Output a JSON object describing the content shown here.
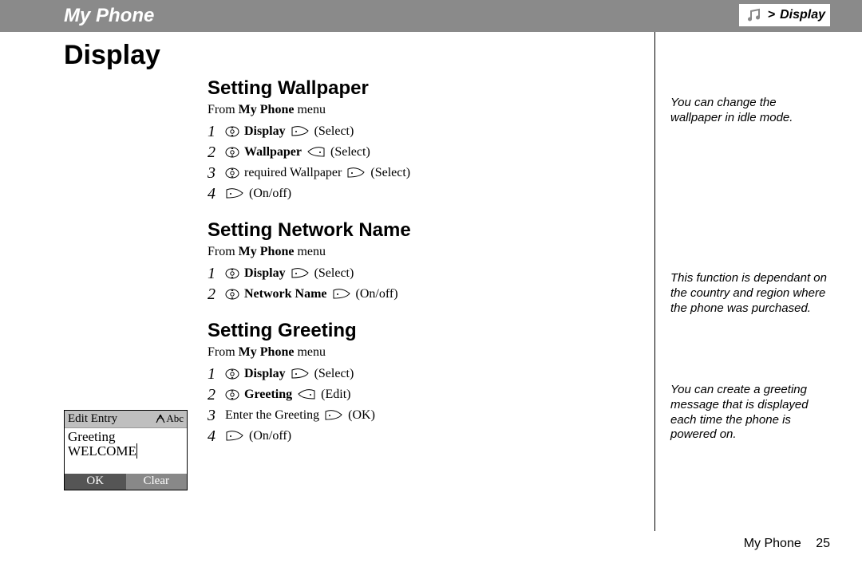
{
  "header": {
    "title": "My Phone"
  },
  "breadcrumb": {
    "arrow": ">",
    "label": "Display"
  },
  "page": {
    "title": "Display",
    "footer_text": "My Phone",
    "footer_page": "25"
  },
  "sections": {
    "wallpaper": {
      "title": "Setting Wallpaper",
      "from_pre": "From ",
      "from_bold": "My Phone",
      "from_post": " menu",
      "s1_num": "1",
      "s1_bold": "Display",
      "s1_paren": "(Select)",
      "s2_num": "2",
      "s2_bold": "Wallpaper",
      "s2_paren": "(Select)",
      "s3_num": "3",
      "s3_text": "required Wallpaper",
      "s3_paren": "(Select)",
      "s4_num": "4",
      "s4_paren": "(On/off)",
      "side_note": "You can change the wallpaper in idle mode."
    },
    "network": {
      "title": "Setting Network Name",
      "from_pre": "From ",
      "from_bold": "My Phone",
      "from_post": " menu",
      "s1_num": "1",
      "s1_bold": "Display",
      "s1_paren": "(Select)",
      "s2_num": "2",
      "s2_bold": "Network Name",
      "s2_paren": "(On/off)",
      "side_note": "This function is dependant on the country and region where the phone was purchased."
    },
    "greeting": {
      "title": "Setting Greeting",
      "from_pre": "From ",
      "from_bold": "My Phone",
      "from_post": " menu",
      "s1_num": "1",
      "s1_bold": "Display",
      "s1_paren": "(Select)",
      "s2_num": "2",
      "s2_bold": "Greeting",
      "s2_paren": "(Edit)",
      "s3_num": "3",
      "s3_text": "Enter the Greeting",
      "s3_paren": "(OK)",
      "s4_num": "4",
      "s4_paren": "(On/off)",
      "side_note": "You can create a greeting message that is displayed each time the phone is powered on."
    }
  },
  "phone_screen": {
    "title": "Edit Entry",
    "mode": "Abc",
    "line1": "Greeting",
    "line2": "WELCOME",
    "sk_left": "OK",
    "sk_right": "Clear"
  }
}
